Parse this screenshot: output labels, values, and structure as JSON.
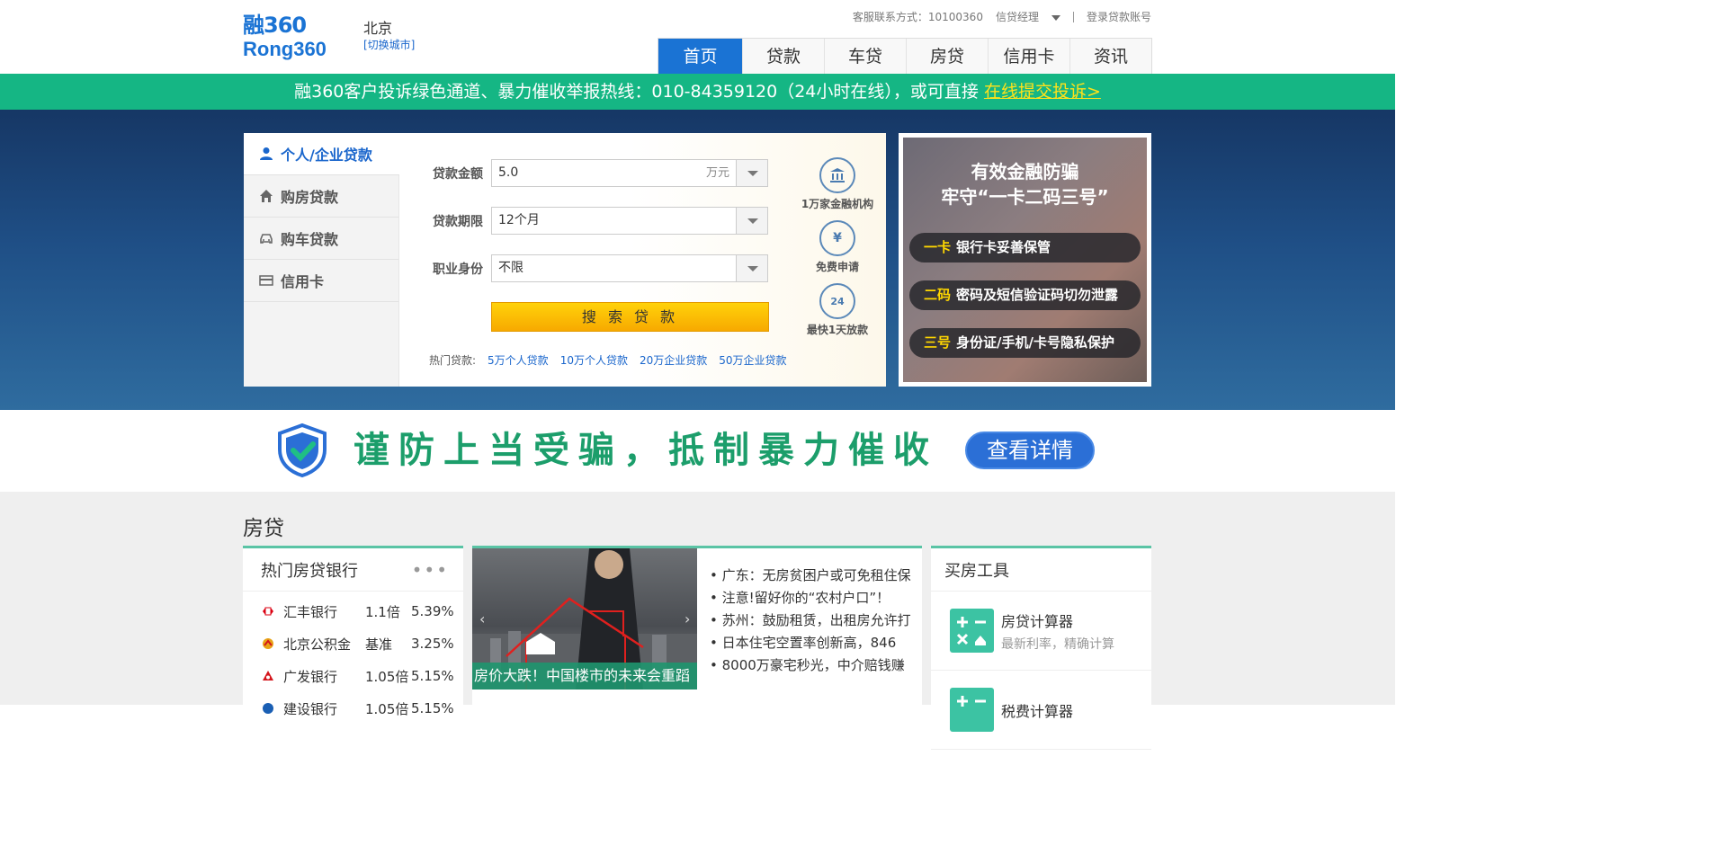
{
  "header": {
    "logo_line1": "融360",
    "logo_line2": "Rong360",
    "city": "北京",
    "city_switch": "[切换城市]",
    "service_label": "客服联系方式：10100360",
    "manager_label": "信贷经理",
    "login_label": "登录贷款账号",
    "nav": [
      "首页",
      "贷款",
      "车贷",
      "房贷",
      "信用卡",
      "资讯"
    ],
    "nav_active": "首页"
  },
  "notice": {
    "text": "融360客户投诉绿色通道、暴力催收举报热线：010-84359120（24小时在线），或可直接 ",
    "link": "在线提交投诉>"
  },
  "search": {
    "tabs": [
      "个人/企业贷款",
      "购房贷款",
      "购车贷款",
      "信用卡"
    ],
    "active_tab": "个人/企业贷款",
    "amount_label": "贷款金额",
    "amount_value": "5.0",
    "amount_unit": "万元",
    "term_label": "贷款期限",
    "term_value": "12个月",
    "job_label": "职业身份",
    "job_value": "不限",
    "button": "搜 索 贷 款",
    "hot_label": "热门贷款:",
    "hot_links": [
      "5万个人贷款",
      "10万个人贷款",
      "20万企业贷款",
      "50万企业贷款"
    ],
    "features": [
      {
        "icon": "bank-icon",
        "text": "1万家金融机构"
      },
      {
        "icon": "yuan-icon",
        "text": "免费申请"
      },
      {
        "icon": "clock-24-icon",
        "text": "最快1天放款"
      }
    ]
  },
  "promo": {
    "title1": "有效金融防骗",
    "title2": "牢守“一卡二码三号”",
    "rows": [
      {
        "key": "一卡",
        "text": "银行卡妥善保管"
      },
      {
        "key": "二码",
        "text": "密码及短信验证码切勿泄露"
      },
      {
        "key": "三号",
        "text": "身份证/手机/卡号隐私保护"
      }
    ]
  },
  "banner": {
    "text": "谨防上当受骗，抵制暴力催收",
    "button": "查看详情"
  },
  "mortgage": {
    "section_title": "房贷",
    "hot_banks_title": "热门房贷银行",
    "more": "•••",
    "banks": [
      {
        "name": "汇丰银行",
        "multiple": "1.1倍",
        "rate": "5.39%",
        "color": "#db0011"
      },
      {
        "name": "北京公积金",
        "multiple": "基准",
        "rate": "3.25%",
        "color": "#e8a317"
      },
      {
        "name": "广发银行",
        "multiple": "1.05倍",
        "rate": "5.15%",
        "color": "#d4161c"
      },
      {
        "name": "建设银行",
        "multiple": "1.05倍",
        "rate": "5.15%",
        "color": "#1a5fb4"
      }
    ],
    "news_caption": "房价大跌！中国楼市的未来会重蹈",
    "news": [
      "• 广东：无房贫困户或可免租住保",
      "• 注意!留好你的“农村户口”！",
      "• 苏州：鼓励租赁，出租房允许打",
      "• 日本住宅空置率创新高，846",
      "• 8000万豪宅秒光，中介赔钱赚"
    ],
    "tools_title": "买房工具",
    "tools": [
      {
        "name": "房贷计算器",
        "desc": "最新利率，精确计算"
      },
      {
        "name": "税费计算器",
        "desc": ""
      }
    ]
  }
}
